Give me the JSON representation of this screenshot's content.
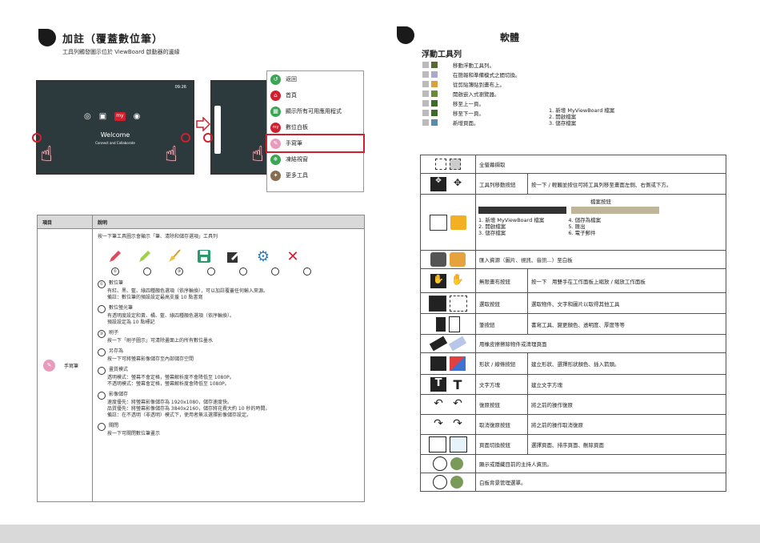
{
  "left": {
    "title": "加註（覆蓋數位筆）",
    "subtitle": "工具列觸發圖示位於 ViewBoard 啟動器的邊緣",
    "screen": {
      "time": "09:26",
      "welcome": "Welcome",
      "welcome_sub": "Connect and Collaborate"
    },
    "menu": [
      {
        "label": "返回",
        "icon": "back-icon",
        "color": "#3aa655"
      },
      {
        "label": "首頁",
        "icon": "home-icon",
        "color": "#d0202e"
      },
      {
        "label": "顯示所有可用應用程式",
        "icon": "apps-icon",
        "color": "#3aa655"
      },
      {
        "label": "數位白板",
        "icon": "whiteboard-icon",
        "color": "#d0202e"
      },
      {
        "label": "手寫筆",
        "icon": "pen-icon",
        "color": "#e89bbd"
      },
      {
        "label": "凍結視窗",
        "icon": "freeze-icon",
        "color": "#3aa655"
      },
      {
        "label": "更多工具",
        "icon": "tools-icon",
        "color": "#8a6d4e"
      }
    ],
    "table": {
      "col_item": "項目",
      "col_desc": "說明",
      "item_label": "手寫筆",
      "intro": "按一下筆工具圖示會顯示「筆、清除和儲存選項」工具列",
      "tool_numbers": [
        "①",
        "",
        "③",
        "",
        "",
        "",
        ""
      ],
      "options": [
        {
          "num": "①",
          "title": "數位筆",
          "lines": [
            "有紅、黑、藍、綠四種顏色選項（依序輪換），可以加註覆蓋任何輸入來源。",
            "備註：數位筆的預設設定最高支援 10 點書寫"
          ]
        },
        {
          "num": "",
          "title": "數位螢光筆",
          "lines": [
            "有透明度設定和黃、橘、藍、綠四種顏色選項（依序輪換）。",
            "預設設定為 10 點標記"
          ]
        },
        {
          "num": "③",
          "title": "刷子",
          "lines": [
            "按一下「刷子圖示」可清除畫面上的所有數位墨水"
          ]
        },
        {
          "num": "",
          "title": "另存為",
          "lines": [
            "按一下可將螢幕影像儲存至內部儲存空間"
          ]
        },
        {
          "num": "",
          "title": "畫質模式",
          "lines": [
            "透明模式：螢幕不會定格，螢幕解析度不會降低至 1080P。",
            "不透明模式：螢幕會定格，螢幕解析度會降低至 1080P。"
          ]
        },
        {
          "num": "",
          "title": "影像儲存",
          "lines": [
            "速度優先：將螢幕影像儲存為 1920x1080，儲存速度快。",
            "品質優先：將螢幕影像儲存為 3840x2160，儲存將花費大約 10 秒的時間。",
            "備註：在不透明（非透明）模式下，使用者無法選擇影像儲存設定。"
          ]
        },
        {
          "num": "",
          "title": "關閉",
          "lines": [
            "按一下可關閉數位筆畫示"
          ]
        }
      ]
    }
  },
  "right": {
    "title": "軟體",
    "section": "浮動工具列",
    "float_items": [
      "移動浮動工具列。",
      "在簡報和準備模式之間切換。",
      "從剪貼簿貼到畫布上。",
      "開啟嵌入式瀏覽器。",
      "移至上一頁。",
      "移至下一頁。",
      "新增頁面。"
    ],
    "side_list": [
      "1. 新增 MyViewBoard 檔案",
      "2. 開啟檔案",
      "3. 儲存檔案"
    ],
    "rows": [
      {
        "c1": "全螢幕擷取",
        "c2": ""
      },
      {
        "c1": "工具列移動按鈕",
        "c2": "按一下 / 輕觸並按住可將工具列移至畫面左側、右側或下方。"
      },
      {
        "c1": "",
        "c2": ""
      },
      {
        "c1": "匯入資源（圖片、視訊、音訊...）至白板",
        "c2": ""
      },
      {
        "c1": "無限畫布按鈕",
        "c2": "按一下　用雙手在工作面板上縮放 / 縮放工作面板"
      },
      {
        "c1": "選取按鈕",
        "c2": "選取物件、文字和圖片以取得其他工具"
      },
      {
        "c1": "筆按鈕",
        "c2": "書寫工具、變更顏色、透明度、厚度等等"
      },
      {
        "c1": "用橡皮擦擦除物件或清理頁面",
        "c2": ""
      },
      {
        "c1": "形狀 / 線條按鈕",
        "c2": "建立形狀、選擇形狀顏色、插入箭頭。"
      },
      {
        "c1": "文字方塊",
        "c2": "建立文字方塊"
      },
      {
        "c1": "復原按鈕",
        "c2": "將之前的操作復原"
      },
      {
        "c1": "取消復原按鈕",
        "c2": "將之前的操作取消復原"
      },
      {
        "c1": "頁面切換按鈕",
        "c2": "選擇頁面、排序頁面、刪除頁面"
      },
      {
        "c1": "顯示或隱藏目前的主持人資訊。",
        "c2": ""
      },
      {
        "c1": "白板背景管理選單。",
        "c2": ""
      }
    ],
    "file_box": {
      "label": "檔案按鈕",
      "list_left": [
        "1. 新增 MyViewBoard 檔案",
        "2. 開啟檔案",
        "3. 儲存檔案"
      ],
      "list_right": [
        "4. 儲存為檔案",
        "5. 匯出",
        "6. 電子郵件"
      ]
    }
  }
}
